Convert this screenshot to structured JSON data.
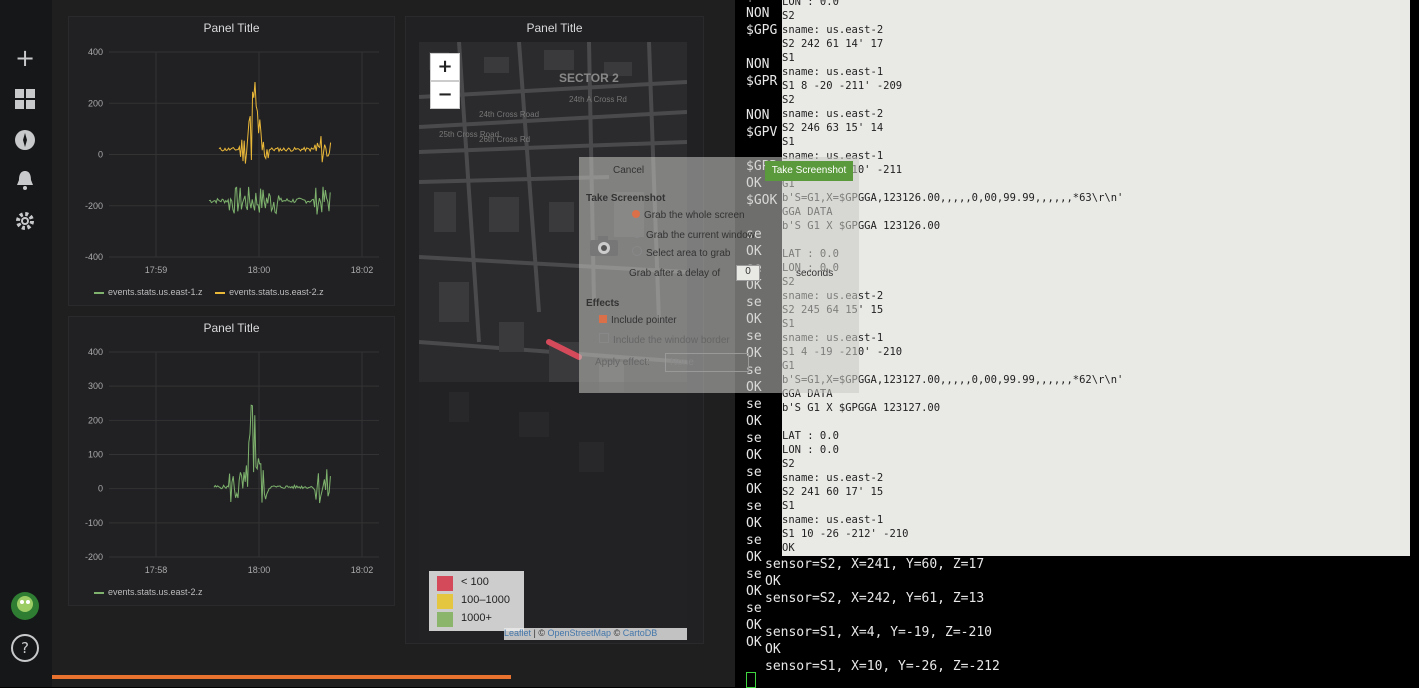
{
  "sidebar": {
    "icons": [
      "plus-icon",
      "dashboard-grid-icon",
      "compass-icon",
      "bell-icon",
      "gear-icon"
    ],
    "help_label": "?"
  },
  "panels": {
    "p1": {
      "title": "Panel Title",
      "xticks": [
        "17:59",
        "18:00",
        "18:02"
      ],
      "yticks": [
        "400",
        "200",
        "0",
        "-200",
        "-400"
      ],
      "legend": [
        {
          "name": "events.stats.us.east-1.z",
          "color": "#7eb26d"
        },
        {
          "name": "events.stats.us.east-2.z",
          "color": "#eab839"
        }
      ]
    },
    "p2": {
      "title": "Panel Title",
      "xticks": [
        "17:58",
        "18:00",
        "18:02"
      ],
      "yticks": [
        "400",
        "300",
        "200",
        "100",
        "0",
        "-100",
        "-200"
      ],
      "legend": [
        {
          "name": "events.stats.us.east-2.z",
          "color": "#7eb26d"
        }
      ]
    },
    "p3": {
      "title": "Panel Title"
    }
  },
  "map": {
    "zoom_in": "+",
    "zoom_out": "−",
    "labels": [
      "SECTOR 2",
      "24th A Cross Rd",
      "24th Cross Road",
      "25th Cross Road",
      "26th Cross Rd"
    ],
    "legend": [
      {
        "label": "< 100",
        "color": "#d44a5a"
      },
      {
        "label": "100–1000",
        "color": "#e5c640"
      },
      {
        "label": "1000+",
        "color": "#8ab56a"
      }
    ],
    "attribution": {
      "leaflet": "Leaflet",
      "sep": " | © ",
      "osm": "OpenStreetMap",
      "sep2": " © ",
      "carto": "CartoDB"
    }
  },
  "dialog": {
    "cancel": "Cancel",
    "take": "Take Screenshot",
    "heading": "Take Screenshot",
    "opt_whole": "Grab the whole screen",
    "opt_window": "Grab the current window",
    "opt_area": "Select area to grab",
    "delay_label": "Grab after a delay of",
    "delay_value": "0",
    "delay_unit": "seconds",
    "effects": "Effects",
    "include_pointer": "Include pointer",
    "include_border": "Include the window border",
    "apply_effect": "Apply effect:",
    "apply_value": "None"
  },
  "gedit_lines": [
    "LON : 0.0",
    "S2",
    "sname: us.east-2",
    "S2 242 61 14' 17",
    "S1",
    "sname: us.east-1",
    "S1 8 -20 -211' -209",
    "S2",
    "sname: us.east-2",
    "S2 246 63 15' 14",
    "S1",
    "sname: us.east-1",
    "S1 4 -21 -210' -211",
    "G1",
    "b'S=G1,X=$GPGGA,123126.00,,,,,0,00,99.99,,,,,,*63\\r\\n'",
    "GGA DATA",
    "b'S G1 X $GPGGA 123126.00",
    "",
    "LAT : 0.0",
    "LON : 0.0",
    "S2",
    "sname: us.east-2",
    "S2 245 64 15' 15",
    "S1",
    "sname: us.east-1",
    "S1 4 -19 -210' -210",
    "G1",
    "b'S=G1,X=$GPGGA,123127.00,,,,,0,00,99.99,,,,,,*62\\r\\n'",
    "GGA DATA",
    "b'S G1 X $GPGGA 123127.00",
    "",
    "LAT : 0.0",
    "LON : 0.0",
    "S2",
    "sname: us.east-2",
    "S2 241 60 17' 15",
    "S1",
    "sname: us.east-1",
    "S1 10 -26 -212' -210",
    "OK"
  ],
  "left_col_lines": [
    "$GPG",
    "NON",
    "$GPG",
    "",
    "NON",
    "$GPR",
    "",
    "NON",
    "$GPV",
    "",
    "$GPR",
    "OK",
    "$GOK",
    "",
    "se",
    "OK",
    "se",
    "OK",
    "se",
    "OK",
    "se",
    "OK",
    "se",
    "OK",
    "se",
    "OK",
    "se",
    "OK",
    "se",
    "OK",
    "se",
    "OK",
    "se",
    "OK",
    "se",
    "OK",
    "se",
    "OK",
    "OK"
  ],
  "bottom_term_lines": [
    "sensor=S2, X=241, Y=60, Z=17",
    "OK",
    "sensor=S2, X=242, Y=61, Z=13",
    "",
    "sensor=S1, X=4, Y=-19, Z=-210",
    "OK",
    "sensor=S1, X=10, Y=-26, Z=-212"
  ],
  "progress": 0.82
}
